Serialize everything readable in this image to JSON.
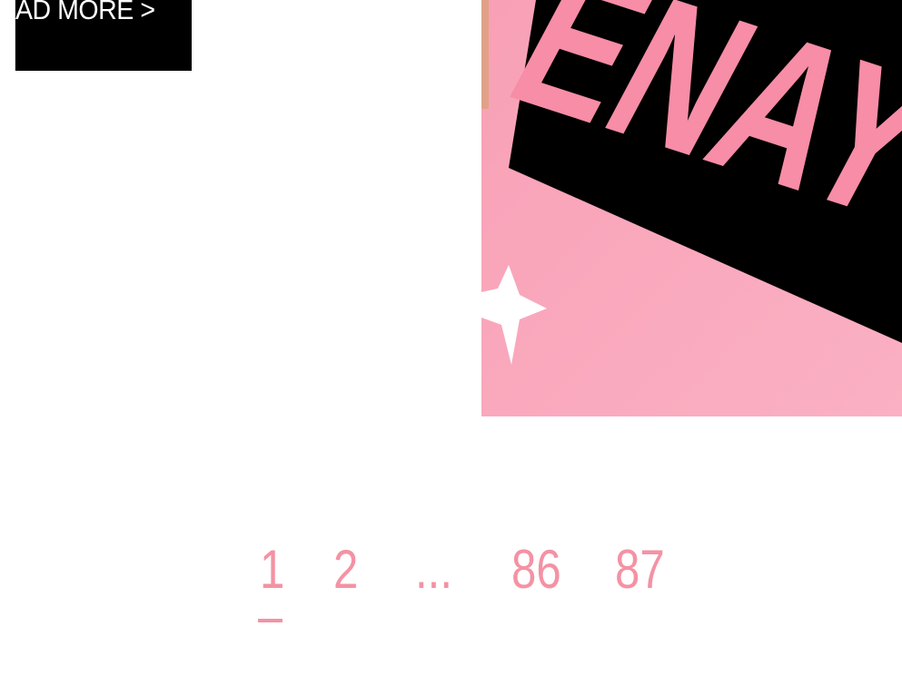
{
  "read_more": {
    "label": "AD MORE >"
  },
  "featured_image": {
    "text": "ENAY",
    "colors": {
      "background_pink": "#f9a6bb",
      "text_pink": "#f78da6",
      "banner_black": "#000000",
      "star_white": "#ffffff"
    },
    "star_icon": "star-icon"
  },
  "pagination": {
    "pages": [
      "1",
      "2",
      "...",
      "86",
      "87"
    ],
    "current": "1",
    "color": "#f492a4"
  }
}
